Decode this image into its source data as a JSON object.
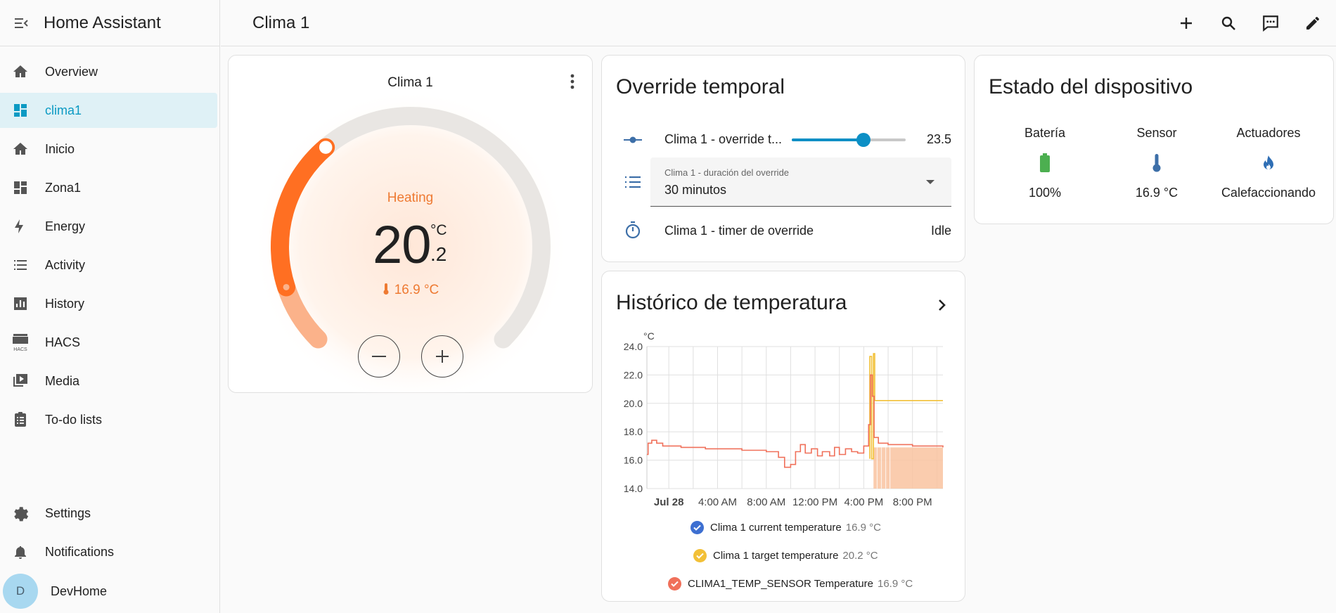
{
  "app": {
    "title": "Home Assistant"
  },
  "sidebar": {
    "items": [
      {
        "label": "Overview",
        "icon": "home-icon"
      },
      {
        "label": "clima1",
        "icon": "dashboard-icon",
        "active": true
      },
      {
        "label": "Inicio",
        "icon": "home-icon"
      },
      {
        "label": "Zona1",
        "icon": "dashboard-icon"
      },
      {
        "label": "Energy",
        "icon": "lightning-icon"
      },
      {
        "label": "Activity",
        "icon": "list-icon"
      },
      {
        "label": "History",
        "icon": "chart-box-icon"
      },
      {
        "label": "HACS",
        "icon": "hacs-icon"
      },
      {
        "label": "Media",
        "icon": "media-icon"
      },
      {
        "label": "To-do lists",
        "icon": "clipboard-list-icon"
      }
    ],
    "settings_label": "Settings",
    "notifications_label": "Notifications",
    "user": {
      "initial": "D",
      "name": "DevHome"
    }
  },
  "header": {
    "title": "Clima 1"
  },
  "thermostat": {
    "name": "Clima 1",
    "action": "Heating",
    "target_whole": "20",
    "target_decimal": ".2",
    "unit": "°C",
    "current": "16.9 °C",
    "minus_label": "−",
    "plus_label": "+",
    "target_level": 0.35,
    "accent": "#ff6f22"
  },
  "override": {
    "title": "Override temporal",
    "slider_name": "Clima 1 - override t...",
    "slider_value": "23.5",
    "slider_level": 0.63,
    "select_label": "Clima 1 - duración del override",
    "select_value": "30 minutos",
    "timer_name": "Clima 1 - timer de override",
    "timer_value": "Idle"
  },
  "history": {
    "title": "Histórico de temperatura",
    "legend": [
      {
        "name": "Clima 1 current temperature",
        "value": "16.9 °C",
        "color": "#3d6fd1"
      },
      {
        "name": "Clima 1 target temperature",
        "value": "20.2 °C",
        "color": "#f2c037"
      },
      {
        "name": "CLIMA1_TEMP_SENSOR Temperature",
        "value": "16.9 °C",
        "color": "#f0705a"
      }
    ]
  },
  "chart_data": {
    "type": "line",
    "ylabel": "°C",
    "ylim": [
      14,
      24
    ],
    "yticks": [
      "24.0",
      "22.0",
      "20.0",
      "18.0",
      "16.0",
      "14.0"
    ],
    "xticks": [
      "Jul 28",
      "4:00 AM",
      "8:00 AM",
      "12:00 PM",
      "4:00 PM",
      "8:00 PM"
    ],
    "xrange_hours": [
      -1.8,
      22.5
    ],
    "series": [
      {
        "name": "Clima 1 target temperature",
        "color": "#f2c037",
        "points": [
          [
            16.5,
            16.1
          ],
          [
            16.5,
            23.3
          ],
          [
            16.65,
            23.3
          ],
          [
            16.65,
            16.1
          ],
          [
            16.8,
            16.1
          ],
          [
            16.8,
            23.5
          ],
          [
            16.9,
            23.5
          ],
          [
            16.9,
            20.2
          ],
          [
            22.5,
            20.2
          ]
        ]
      },
      {
        "name": "CLIMA1_TEMP_SENSOR Temperature",
        "color": "#f0705a",
        "points": [
          [
            -1.8,
            16.4
          ],
          [
            -1.7,
            17.2
          ],
          [
            -1.4,
            17.4
          ],
          [
            -1.0,
            17.2
          ],
          [
            -0.5,
            17.0
          ],
          [
            1.0,
            16.9
          ],
          [
            3.0,
            16.8
          ],
          [
            5.0,
            16.8
          ],
          [
            6.0,
            16.7
          ],
          [
            8.0,
            16.6
          ],
          [
            9.0,
            16.2
          ],
          [
            9.5,
            15.5
          ],
          [
            10.0,
            15.7
          ],
          [
            10.4,
            16.6
          ],
          [
            10.8,
            17.1
          ],
          [
            11.2,
            16.5
          ],
          [
            11.7,
            16.8
          ],
          [
            12.2,
            16.3
          ],
          [
            12.6,
            16.6
          ],
          [
            13.2,
            16.3
          ],
          [
            13.6,
            16.9
          ],
          [
            14.0,
            16.4
          ],
          [
            14.5,
            16.8
          ],
          [
            15.0,
            16.6
          ],
          [
            15.5,
            16.5
          ],
          [
            16.0,
            17.0
          ],
          [
            16.4,
            18.5
          ],
          [
            16.55,
            22.0
          ],
          [
            16.7,
            20.5
          ],
          [
            16.85,
            17.6
          ],
          [
            17.2,
            17.2
          ],
          [
            18.0,
            17.1
          ],
          [
            20.0,
            17.0
          ],
          [
            22.5,
            16.9
          ]
        ]
      }
    ],
    "area_from_hours": 16.8,
    "area_color": "#f9c3a0"
  },
  "device": {
    "title": "Estado del dispositivo",
    "columns": [
      {
        "label": "Batería",
        "value": "100%",
        "icon": "battery-icon",
        "color": "#4caf50"
      },
      {
        "label": "Sensor",
        "value": "16.9 °C",
        "icon": "thermometer-icon",
        "color": "#3d6fa8"
      },
      {
        "label": "Actuadores",
        "value": "Calefaccionando",
        "icon": "fire-icon",
        "color": "#2f6fb5"
      }
    ]
  }
}
